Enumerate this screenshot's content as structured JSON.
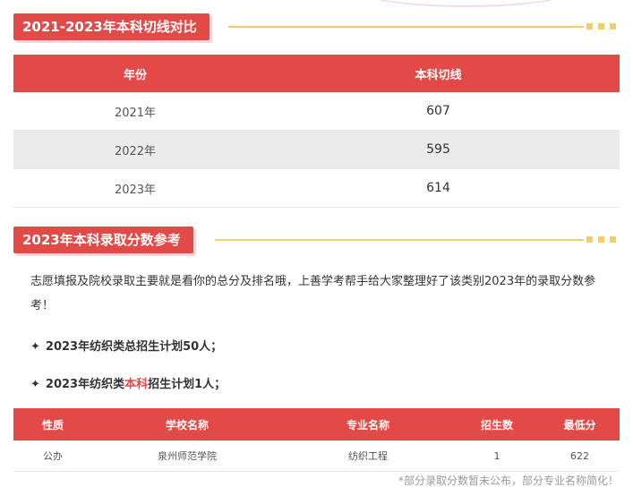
{
  "section1": {
    "title": "2021-2023年本科切线对比"
  },
  "cutoff_table": {
    "headers": [
      "年份",
      "本科切线"
    ],
    "rows": [
      [
        "2021年",
        "607"
      ],
      [
        "2022年",
        "595"
      ],
      [
        "2023年",
        "614"
      ]
    ]
  },
  "section2": {
    "title": "2023年本科录取分数参考"
  },
  "intro": "志愿填报及院校录取主要就是看你的总分及排名哦，上善学考帮手给大家整理好了该类别2023年的录取分数参考！",
  "bullets": {
    "b1": {
      "star": "✦",
      "text": "2023年纺织类总招生计划50人；"
    },
    "b2": {
      "star": "✦",
      "pre": "2023年纺织类",
      "highlight": "本科",
      "post": "招生计划1人；"
    }
  },
  "admission_table": {
    "headers": [
      "性质",
      "学校名称",
      "专业名称",
      "招生数",
      "最低分"
    ],
    "rows": [
      [
        "公办",
        "泉州师范学院",
        "纺织工程",
        "1",
        "622"
      ]
    ]
  },
  "footnote": "*部分录取分数暂未公布，部分专业名称简化！",
  "colors": {
    "accent": "#e14a47",
    "line": "#f0cf6a",
    "stripe": "#eaeaea"
  }
}
